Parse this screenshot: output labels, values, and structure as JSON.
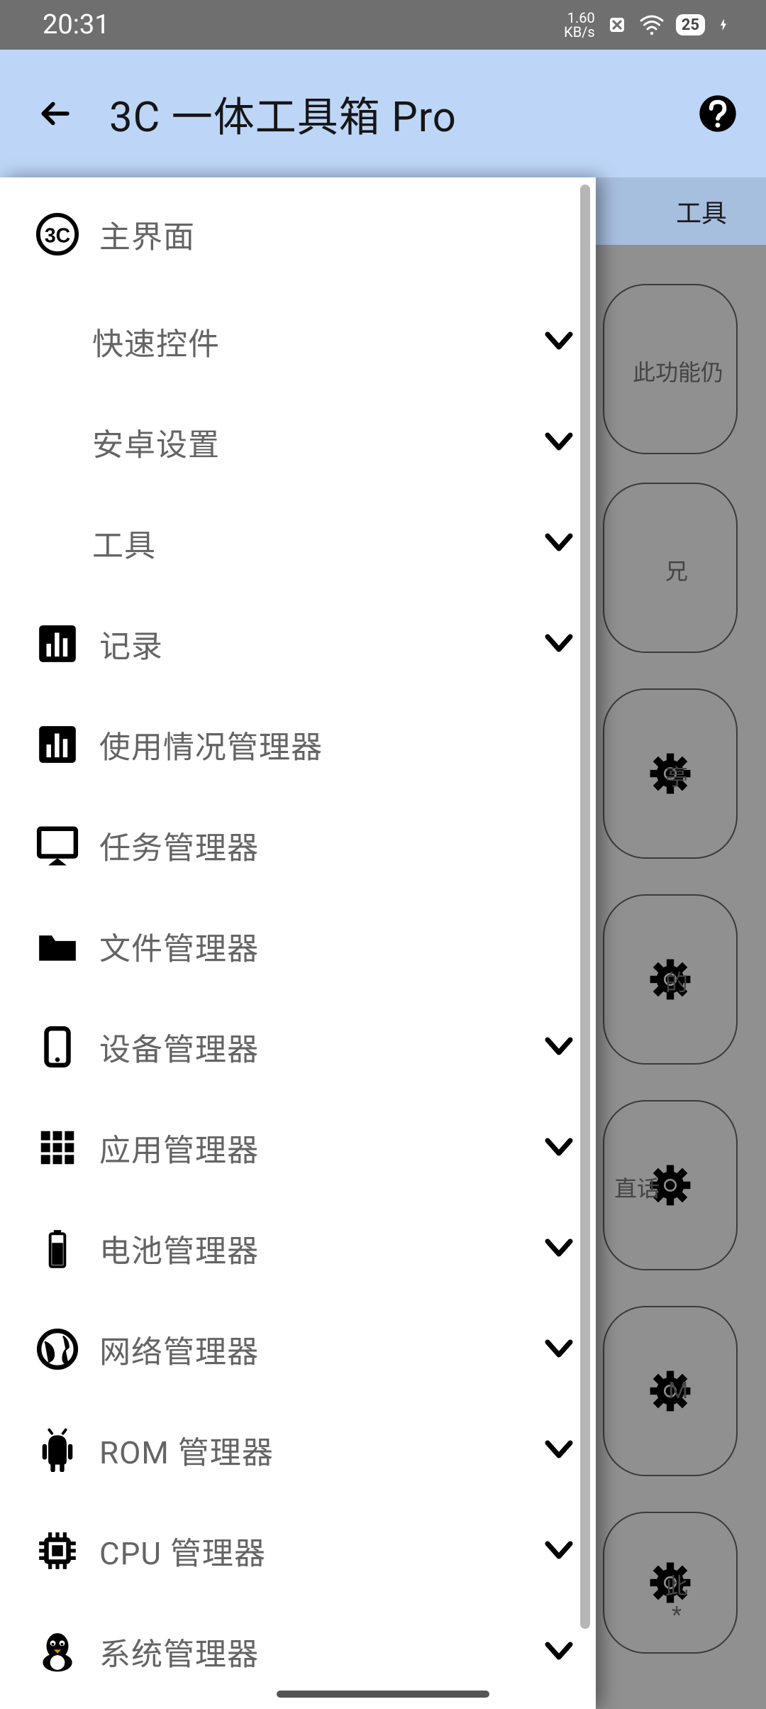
{
  "status": {
    "time": "20:31",
    "kbps": "1.60",
    "kbps_unit": "KB/s",
    "battery": "25"
  },
  "header": {
    "title": "3C 一体工具箱 Pro"
  },
  "backdrop": {
    "tab": "工具",
    "items": [
      {
        "label": "此功能仍"
      },
      {
        "label": "兄"
      },
      {
        "label": "亭",
        "gear": true
      },
      {
        "label": "的",
        "gear": true
      },
      {
        "label": "直话",
        "gear": true
      },
      {
        "label": "M",
        "gear": true
      },
      {
        "label": "此\n * ",
        "gear": true
      }
    ]
  },
  "drawer": [
    {
      "icon": "3c-icon",
      "label": "主界面"
    },
    {
      "sub": true,
      "label": "快速控件",
      "chev": true
    },
    {
      "sub": true,
      "label": "安卓设置",
      "chev": true
    },
    {
      "sub": true,
      "label": "工具",
      "chev": true
    },
    {
      "icon": "chart-icon",
      "label": "记录",
      "chev": true
    },
    {
      "icon": "chart-icon",
      "label": "使用情况管理器"
    },
    {
      "icon": "monitor-icon",
      "label": "任务管理器"
    },
    {
      "icon": "folder-icon",
      "label": "文件管理器"
    },
    {
      "icon": "phone-icon",
      "label": "设备管理器",
      "chev": true
    },
    {
      "icon": "apps-icon",
      "label": "应用管理器",
      "chev": true
    },
    {
      "icon": "battery-icon",
      "label": "电池管理器",
      "chev": true
    },
    {
      "icon": "globe-icon",
      "label": "网络管理器",
      "chev": true
    },
    {
      "icon": "android-icon",
      "label": "ROM 管理器",
      "chev": true
    },
    {
      "icon": "cpu-icon",
      "label": "CPU 管理器",
      "chev": true
    },
    {
      "icon": "tux-icon",
      "label": "系统管理器",
      "chev": true
    }
  ]
}
